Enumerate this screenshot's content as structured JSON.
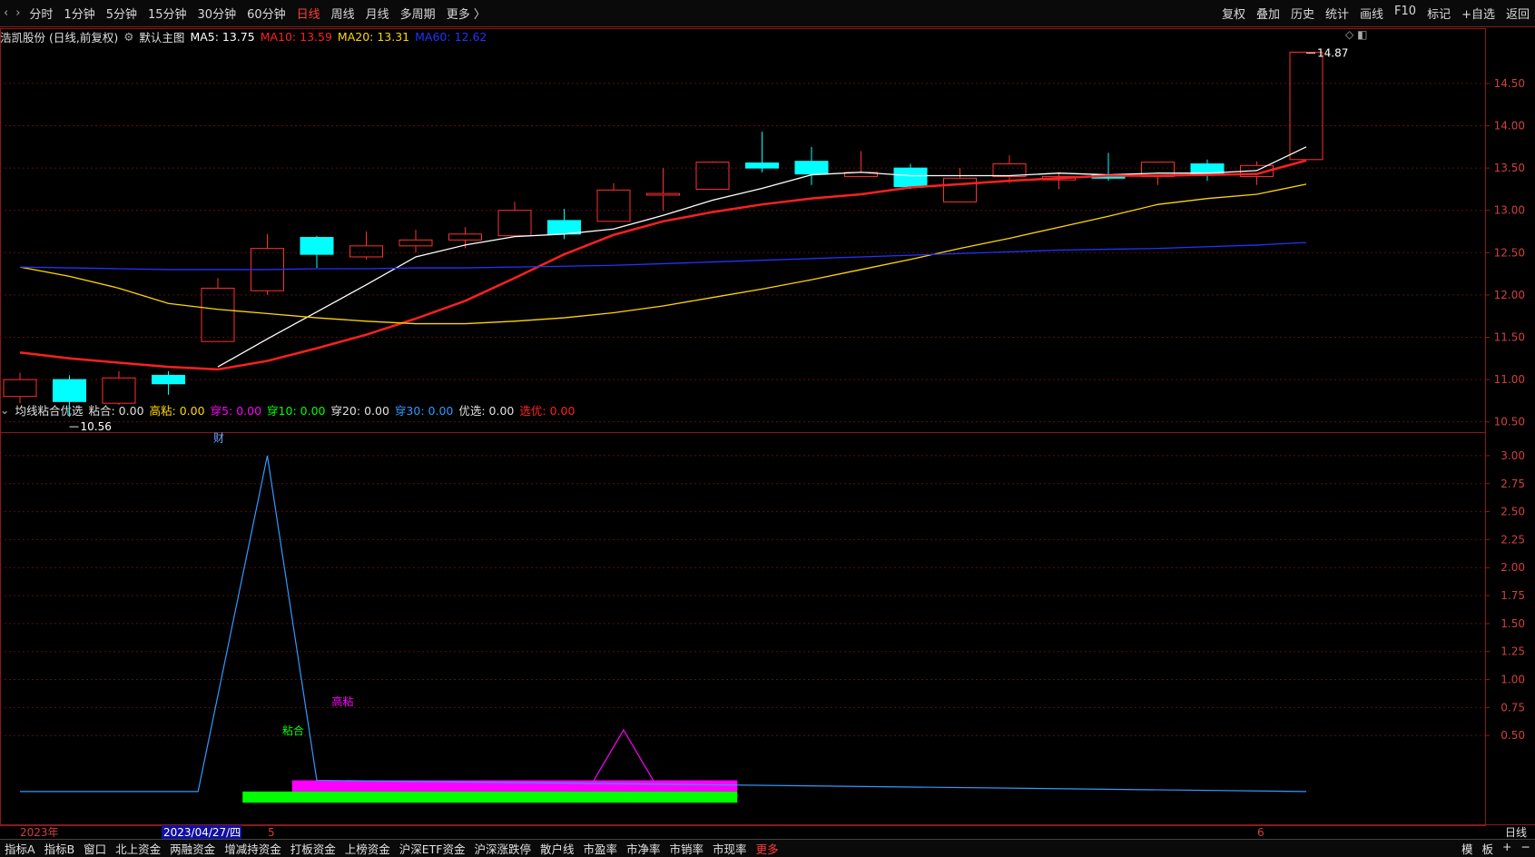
{
  "topbar": {
    "nav": [
      "‹",
      "›"
    ],
    "period_tabs": [
      {
        "label": "分时",
        "active": false
      },
      {
        "label": "1分钟",
        "active": false
      },
      {
        "label": "5分钟",
        "active": false
      },
      {
        "label": "15分钟",
        "active": false
      },
      {
        "label": "30分钟",
        "active": false
      },
      {
        "label": "60分钟",
        "active": false
      },
      {
        "label": "日线",
        "active": true
      },
      {
        "label": "周线",
        "active": false
      },
      {
        "label": "月线",
        "active": false
      },
      {
        "label": "多周期",
        "active": false
      },
      {
        "label": "更多 〉",
        "active": false
      }
    ],
    "tools": [
      "复权",
      "叠加",
      "历史",
      "统计",
      "画线",
      "F10",
      "标记",
      "+自选",
      "返回"
    ]
  },
  "main_info": {
    "stock": "浩凯股份 (日线,前复权)",
    "template": "默认主图",
    "ma": [
      {
        "label": "MA5: 13.75",
        "color": "#ffffff"
      },
      {
        "label": "MA10: 13.59",
        "color": "#ff2020"
      },
      {
        "label": "MA20: 13.31",
        "color": "#ffd700"
      },
      {
        "label": "MA60: 12.62",
        "color": "#2233ff"
      }
    ]
  },
  "sub_info": {
    "name": "均线粘合优选",
    "items": [
      {
        "label": "粘合: 0.00",
        "color": "#e0e0e0"
      },
      {
        "label": "高粘: 0.00",
        "color": "#ffd700"
      },
      {
        "label": "穿5: 0.00",
        "color": "#ff00ff"
      },
      {
        "label": "穿10: 0.00",
        "color": "#00ff00"
      },
      {
        "label": "穿20: 0.00",
        "color": "#e0e0e0"
      },
      {
        "label": "穿30: 0.00",
        "color": "#3399ff"
      },
      {
        "label": "优选: 0.00",
        "color": "#e0e0e0"
      },
      {
        "label": "选优: 0.00",
        "color": "#ff2020"
      }
    ]
  },
  "chart_data": [
    {
      "type": "candlestick",
      "title": "浩凯股份",
      "y_ticks": [
        "14.50",
        "14.00",
        "13.50",
        "13.00",
        "12.50",
        "12.00",
        "11.50",
        "11.00",
        "10.50"
      ],
      "ylim": [
        10.4,
        14.95
      ],
      "candles": [
        {
          "o": 10.8,
          "c": 11.0,
          "h": 11.08,
          "l": 10.72
        },
        {
          "o": 11.0,
          "c": 10.74,
          "h": 11.05,
          "l": 10.56
        },
        {
          "o": 10.72,
          "c": 11.02,
          "h": 11.1,
          "l": 10.7
        },
        {
          "o": 11.05,
          "c": 10.95,
          "h": 11.1,
          "l": 10.82
        },
        {
          "o": 11.45,
          "c": 12.08,
          "h": 12.2,
          "l": 11.45
        },
        {
          "o": 12.05,
          "c": 12.55,
          "h": 12.72,
          "l": 12.0
        },
        {
          "o": 12.68,
          "c": 12.48,
          "h": 12.7,
          "l": 12.32
        },
        {
          "o": 12.45,
          "c": 12.58,
          "h": 12.75,
          "l": 12.42
        },
        {
          "o": 12.58,
          "c": 12.65,
          "h": 12.77,
          "l": 12.5
        },
        {
          "o": 12.65,
          "c": 12.72,
          "h": 12.8,
          "l": 12.55
        },
        {
          "o": 12.7,
          "c": 13.0,
          "h": 13.1,
          "l": 12.7
        },
        {
          "o": 12.88,
          "c": 12.72,
          "h": 13.02,
          "l": 12.66
        },
        {
          "o": 12.87,
          "c": 13.24,
          "h": 13.32,
          "l": 12.87
        },
        {
          "o": 13.18,
          "c": 13.2,
          "h": 13.5,
          "l": 13.0
        },
        {
          "o": 13.25,
          "c": 13.57,
          "h": 13.58,
          "l": 13.25
        },
        {
          "o": 13.56,
          "c": 13.5,
          "h": 13.93,
          "l": 13.45
        },
        {
          "o": 13.58,
          "c": 13.43,
          "h": 13.75,
          "l": 13.3
        },
        {
          "o": 13.4,
          "c": 13.45,
          "h": 13.7,
          "l": 13.4
        },
        {
          "o": 13.5,
          "c": 13.28,
          "h": 13.55,
          "l": 13.25
        },
        {
          "o": 13.1,
          "c": 13.38,
          "h": 13.5,
          "l": 13.1
        },
        {
          "o": 13.4,
          "c": 13.55,
          "h": 13.65,
          "l": 13.32
        },
        {
          "o": 13.36,
          "c": 13.4,
          "h": 13.45,
          "l": 13.25
        },
        {
          "o": 13.42,
          "c": 13.38,
          "h": 13.68,
          "l": 13.35
        },
        {
          "o": 13.4,
          "c": 13.57,
          "h": 13.57,
          "l": 13.3
        },
        {
          "o": 13.55,
          "c": 13.42,
          "h": 13.6,
          "l": 13.35
        },
        {
          "o": 13.4,
          "c": 13.53,
          "h": 13.58,
          "l": 13.3
        },
        {
          "o": 13.6,
          "c": 14.87,
          "h": 14.87,
          "l": 13.6
        }
      ],
      "series": [
        {
          "name": "MA5",
          "color": "#ffffff",
          "values": [
            null,
            null,
            null,
            null,
            11.15,
            11.48,
            11.8,
            12.12,
            12.45,
            12.59,
            12.69,
            12.72,
            12.78,
            12.94,
            13.12,
            13.26,
            13.42,
            13.45,
            13.41,
            13.41,
            13.41,
            13.44,
            13.42,
            13.44,
            13.44,
            13.47,
            13.75
          ]
        },
        {
          "name": "MA10",
          "color": "#ff2020",
          "values": [
            11.32,
            11.25,
            11.2,
            11.15,
            11.12,
            11.22,
            11.37,
            11.53,
            11.72,
            11.93,
            12.2,
            12.48,
            12.71,
            12.87,
            12.98,
            13.07,
            13.14,
            13.19,
            13.27,
            13.31,
            13.35,
            13.38,
            13.41,
            13.41,
            13.42,
            13.43,
            13.59
          ]
        },
        {
          "name": "MA20",
          "color": "#ffd700",
          "values": [
            12.33,
            12.22,
            12.08,
            11.9,
            11.83,
            11.78,
            11.73,
            11.69,
            11.66,
            11.66,
            11.69,
            11.73,
            11.79,
            11.87,
            11.97,
            12.07,
            12.18,
            12.3,
            12.42,
            12.55,
            12.67,
            12.8,
            12.93,
            13.07,
            13.14,
            13.19,
            13.31
          ]
        },
        {
          "name": "MA60",
          "color": "#2233ff",
          "values": [
            12.33,
            12.32,
            12.31,
            12.3,
            12.3,
            12.3,
            12.31,
            12.31,
            12.32,
            12.32,
            12.33,
            12.34,
            12.35,
            12.37,
            12.39,
            12.41,
            12.43,
            12.45,
            12.47,
            12.49,
            12.51,
            12.53,
            12.54,
            12.55,
            12.57,
            12.59,
            12.62
          ]
        }
      ],
      "annotations": [
        {
          "text": "10.56",
          "bar": 1,
          "value": 10.56
        },
        {
          "text": "14.87",
          "bar": 26,
          "value": 14.87
        },
        {
          "text": "财",
          "bar": 4,
          "value": 10.44
        }
      ]
    },
    {
      "type": "line",
      "title": "均线粘合优选",
      "y_ticks": [
        "3.00",
        "2.75",
        "2.50",
        "2.25",
        "2.00",
        "1.75",
        "1.50",
        "1.25",
        "1.00",
        "0.75",
        "0.50"
      ],
      "ylim": [
        -0.22,
        3.04
      ],
      "x_labels": [
        {
          "text": "2023年",
          "bar": 0
        },
        {
          "text": "2023/04/27/四",
          "bar": 4
        },
        {
          "text": "5",
          "bar": 5
        },
        {
          "text": "6",
          "bar": 25
        },
        {
          "text": "日线",
          "bar": null
        }
      ],
      "series": [
        {
          "name": "粘合线",
          "color": "#3399ff",
          "points": [
            [
              0,
              0
            ],
            [
              3.6,
              0
            ],
            [
              5,
              3
            ],
            [
              6,
              0.1
            ],
            [
              26,
              0
            ]
          ]
        },
        {
          "name": "穿5",
          "color": "#ff00ff",
          "points": [
            [
              11.6,
              0.1
            ],
            [
              12.2,
              0.55
            ],
            [
              12.8,
              0.1
            ]
          ]
        }
      ],
      "bars": [
        {
          "name": "高粘",
          "color": "#ff00ff",
          "from": 5.5,
          "to": 14.5,
          "bottom": 0.0,
          "top": 0.1
        },
        {
          "name": "粘合",
          "color": "#00ff00",
          "from": 4.5,
          "to": 14.5,
          "bottom": -0.1,
          "top": 0.0
        }
      ],
      "labels": [
        {
          "text": "粘合",
          "color": "#00ff00",
          "bar": 5.3,
          "value": 0.51
        },
        {
          "text": "高粘",
          "color": "#ff00ff",
          "bar": 6.3,
          "value": 0.77
        }
      ]
    }
  ],
  "bottombar": {
    "tabs": [
      "指标A",
      "指标B",
      "窗口",
      "北上资金",
      "两融资金",
      "增减持资金",
      "打板资金",
      "上榜资金",
      "沪深ETF资金",
      "沪深涨跌停",
      "散户线",
      "市盈率",
      "市净率",
      "市销率",
      "市现率",
      "更多"
    ],
    "right": [
      "模",
      "板",
      "+",
      "−"
    ]
  }
}
